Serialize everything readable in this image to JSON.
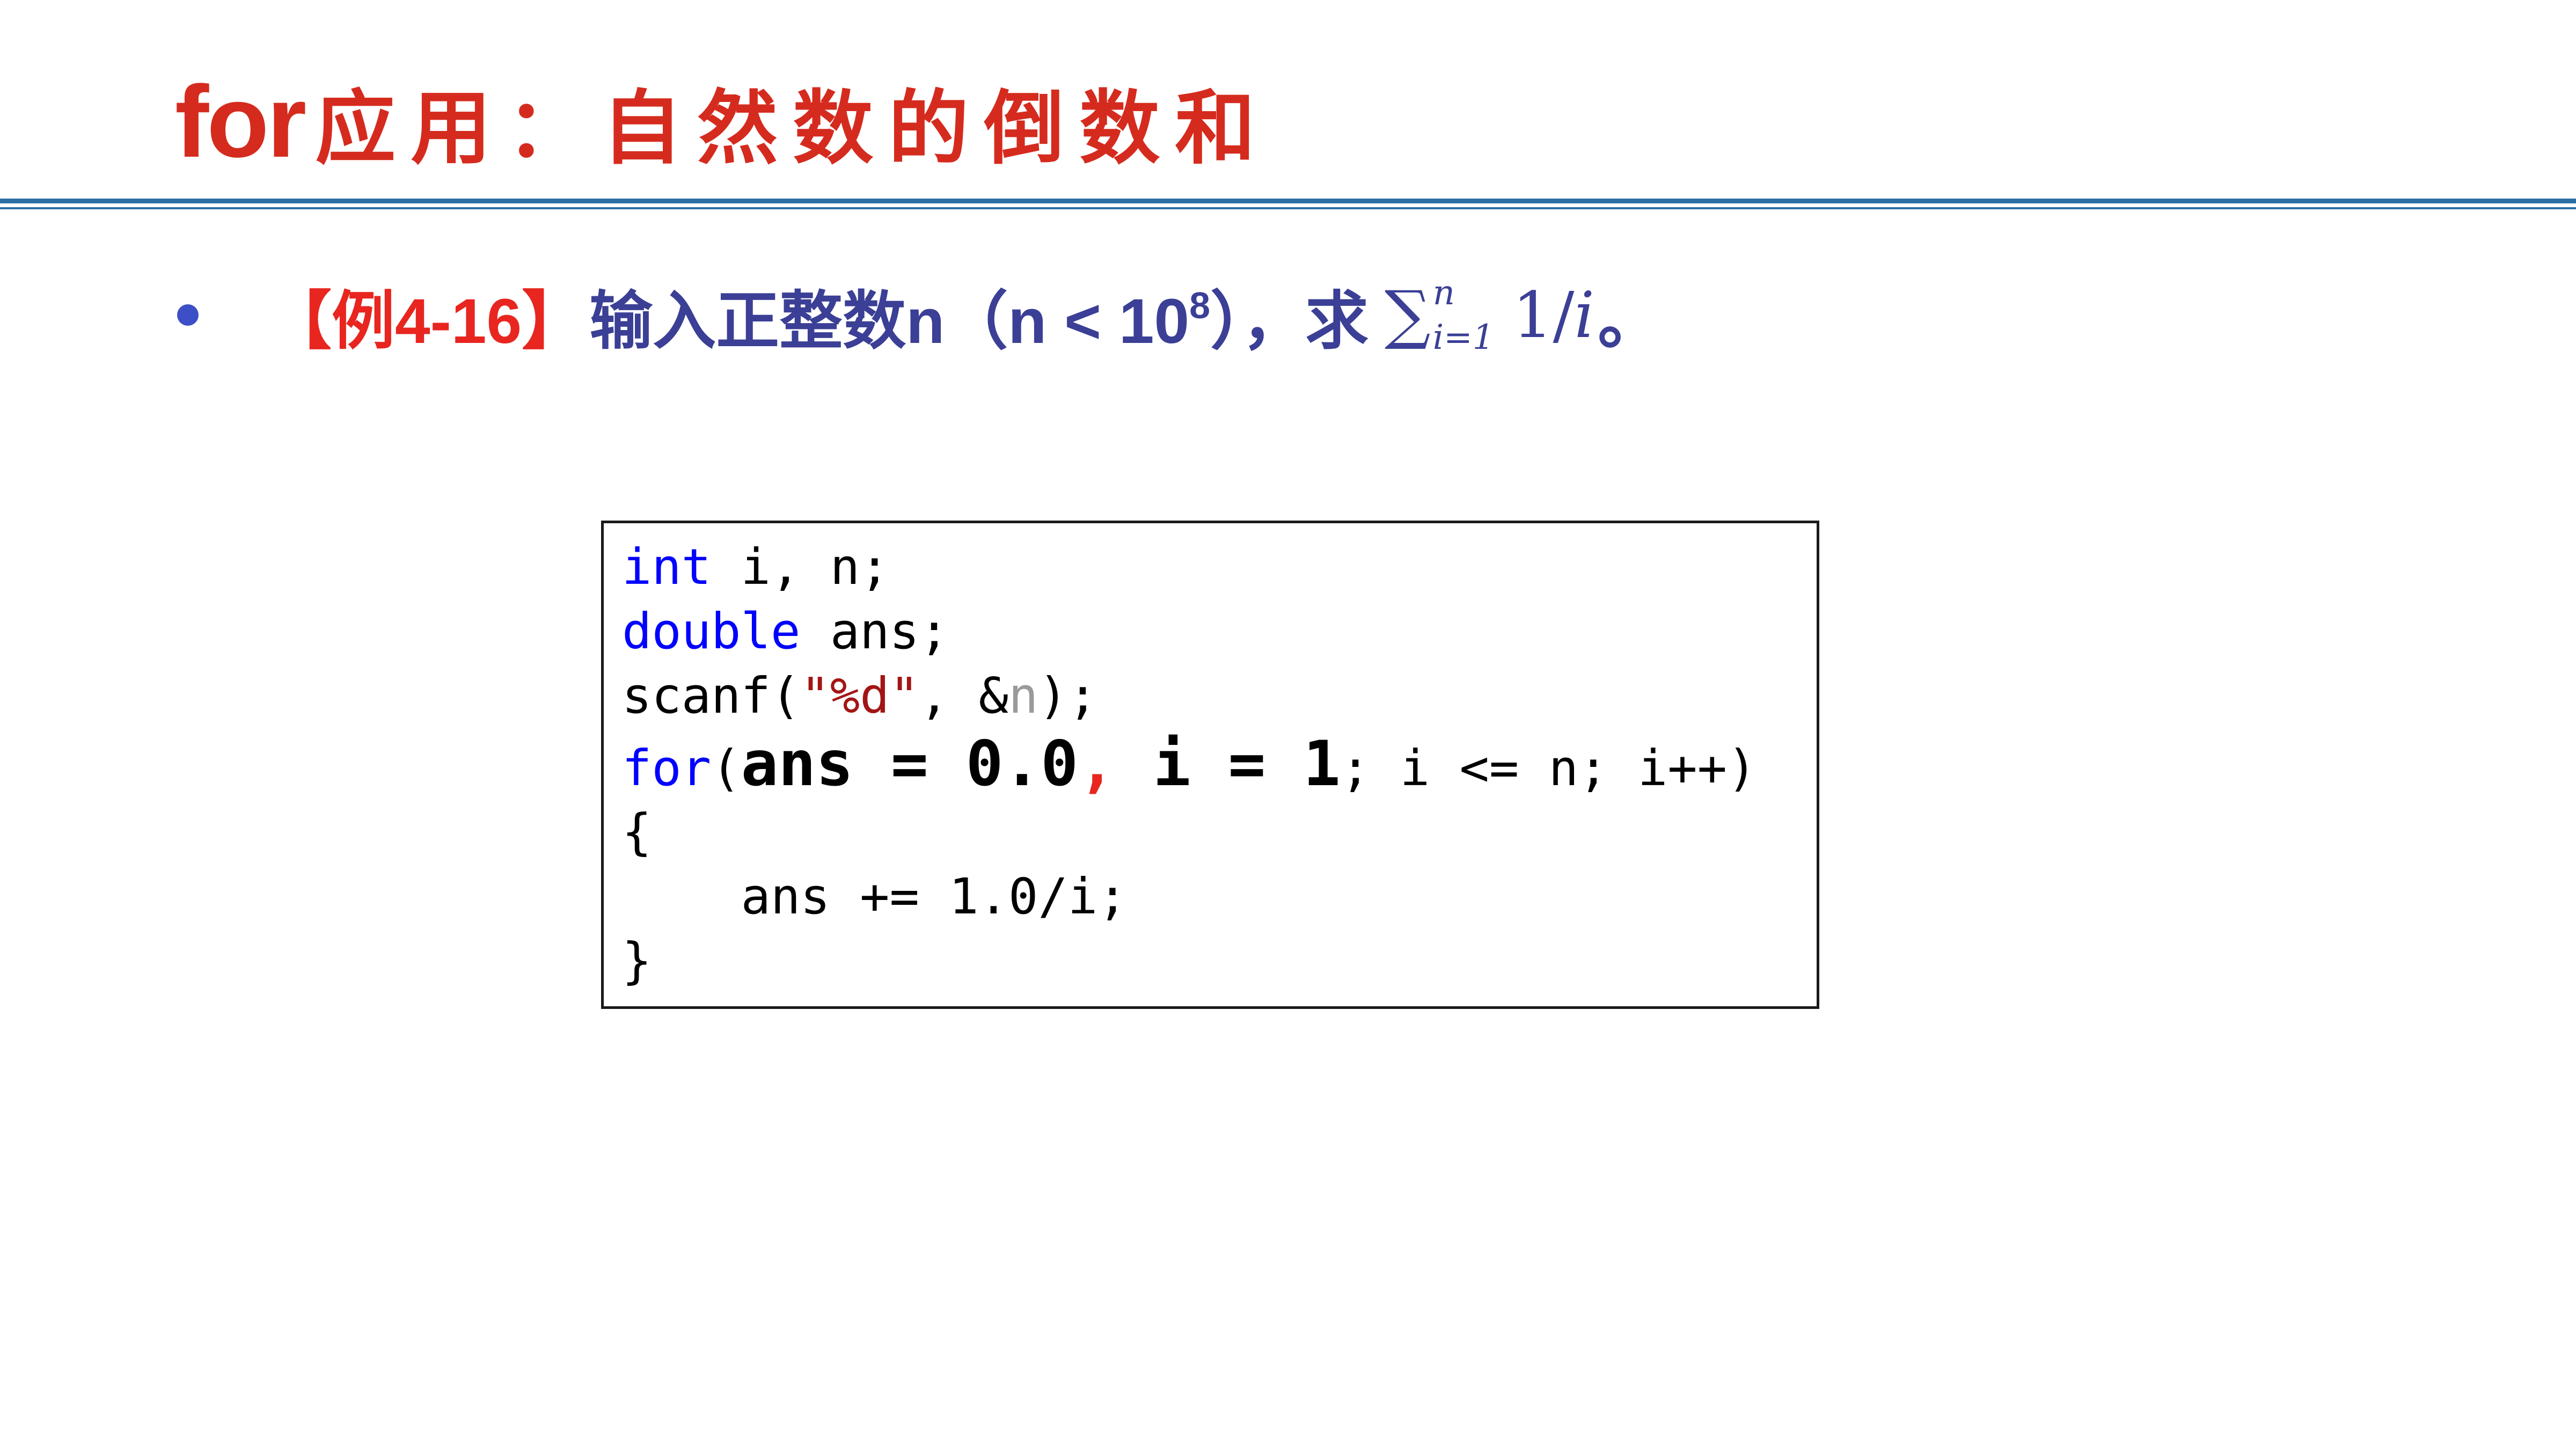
{
  "slide": {
    "title_prefix": "for",
    "title_main": "应用：自然数的倒数和",
    "example_tag": "【例4-16】",
    "problem_text_before_exp": "输入正整数n（n < 10",
    "problem_exponent": "8",
    "problem_text_after_exp": "），求 ",
    "sum_sigma": "∑",
    "sum_upper": "n",
    "sum_lower": "i=1",
    "sum_expr_num": "1/",
    "sum_expr_var": "i",
    "problem_tail": "。"
  },
  "code": {
    "line1_kw": "int",
    "line1_rest": " i, n;",
    "line2_kw": "double",
    "line2_rest": " ans;",
    "line3_a": "scanf(",
    "line3_str": "\"%d\"",
    "line3_b": ", &",
    "line3_n": "n",
    "line3_c": ");",
    "line4_kw": "for",
    "line4_paren": "(",
    "line4_init1": "ans = 0.0",
    "line4_comma": ",",
    "line4_init2": " i = 1",
    "line4_rest": "; i <= n; i++)",
    "line5": "{",
    "line6": "    ans += 1.0/i;",
    "line7": "}"
  },
  "colors": {
    "title": "#d52b1e",
    "rule": "#2c6ea3",
    "bullet_text": "#3b3f95",
    "example_tag": "#e8251f",
    "bullet_dot": "#3d4fc6",
    "keyword": "#0000ff",
    "string": "#a31515"
  }
}
